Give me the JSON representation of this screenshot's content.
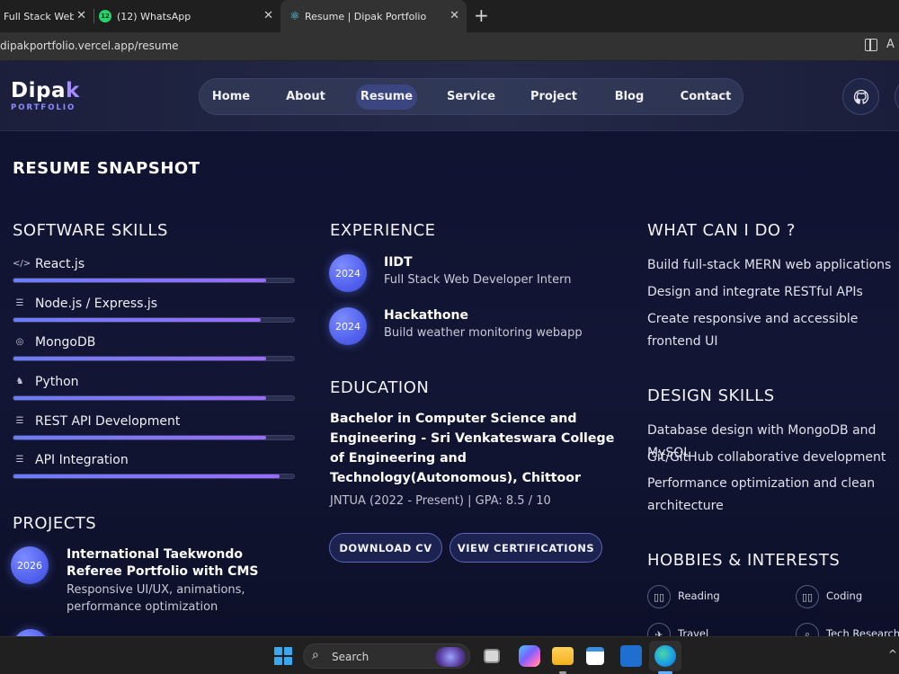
{
  "browser": {
    "tabs": [
      {
        "title": "Full Stack Web Developer"
      },
      {
        "title": "(12) WhatsApp",
        "badge": "12"
      },
      {
        "title": "Resume | Dipak Portfolio"
      }
    ],
    "url": "dipakportfolio.vercel.app/resume"
  },
  "site": {
    "logo_main": "Dipa",
    "logo_accent": "k",
    "logo_sub": "PORTFOLIO",
    "nav": [
      "Home",
      "About",
      "Resume",
      "Service",
      "Project",
      "Blog",
      "Contact"
    ],
    "active_nav": "Resume"
  },
  "resume": {
    "heading": "RESUME SNAPSHOT",
    "skills_title": "SOFTWARE SKILLS",
    "skills": [
      {
        "label": "React.js",
        "icon": "code-icon",
        "level": 0.9
      },
      {
        "label": "Node.js / Express.js",
        "icon": "server-icon",
        "level": 0.88
      },
      {
        "label": "MongoDB",
        "icon": "database-icon",
        "level": 0.9
      },
      {
        "label": "Python",
        "icon": "python-icon",
        "level": 0.9
      },
      {
        "label": "REST API Development",
        "icon": "server-icon",
        "level": 0.9
      },
      {
        "label": "API Integration",
        "icon": "server-icon",
        "level": 0.95
      }
    ],
    "experience_title": "EXPERIENCE",
    "experience": [
      {
        "year": "2024",
        "title": "IIDT",
        "subtitle": "Full Stack Web Developer Intern"
      },
      {
        "year": "2024",
        "title": "Hackathone",
        "subtitle": "Build weather monitoring webapp"
      }
    ],
    "education_title": "EDUCATION",
    "education": {
      "degree": "Bachelor in Computer Science and Engineering - Sri Venkateswara College of Engineering and Technology(Autonomous), Chittoor",
      "meta": "JNTUA (2022 - Present) | GPA: 8.5 / 10"
    },
    "buttons": {
      "download": "DOWNLOAD CV",
      "certifications": "VIEW CERTIFICATIONS"
    },
    "can_do_title": "WHAT CAN I DO ?",
    "can_do": [
      "Build full-stack MERN web applications",
      "Design and integrate RESTful APIs",
      "Create responsive and accessible frontend UI"
    ],
    "design_title": "DESIGN SKILLS",
    "design": [
      "Database design with MongoDB and MySQL",
      "Git/GitHub collaborative development",
      "Performance optimization and clean architecture"
    ],
    "projects_title": "PROJECTS",
    "projects": [
      {
        "year": "2026",
        "title": "International Taekwondo Referee Portfolio with CMS",
        "desc": "Responsive UI/UX, animations, performance optimization"
      }
    ],
    "hobbies_title": "HOBBIES & INTERESTS",
    "hobbies": [
      {
        "label": "Reading",
        "icon": "book-icon"
      },
      {
        "label": "Coding",
        "icon": "book-icon"
      },
      {
        "label": "Travel",
        "icon": "plane-icon"
      },
      {
        "label": "Tech Research",
        "icon": "search-icon"
      }
    ]
  },
  "taskbar": {
    "search_placeholder": "Search"
  },
  "colors": {
    "accent": "#6b7cff",
    "accent2": "#9a6bff",
    "background": "#0f1330"
  }
}
